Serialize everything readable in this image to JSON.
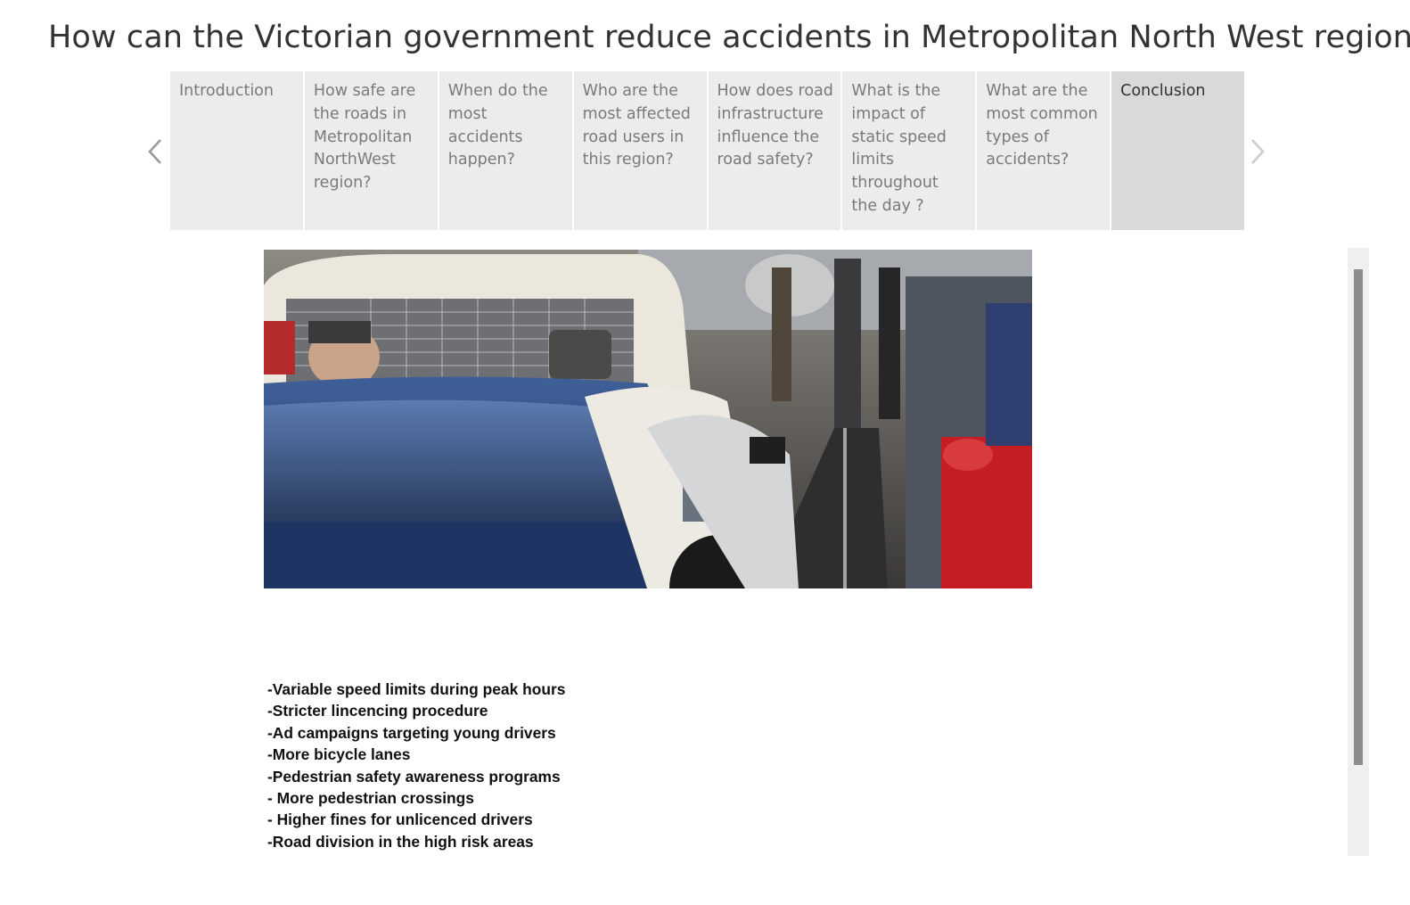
{
  "story": {
    "title": "How can the Victorian government reduce accidents in Metropolitan North West region?"
  },
  "navigation": {
    "prev_icon": "chevron-left-icon",
    "next_icon": "chevron-right-icon",
    "points": [
      {
        "label": "Introduction",
        "active": false
      },
      {
        "label": "How safe are the roads in Metropolitan NorthWest region?",
        "active": false
      },
      {
        "label": "When do the most accidents happen?",
        "active": false
      },
      {
        "label": "Who are the most affected road users in this region?",
        "active": false
      },
      {
        "label": "How does road infrastructure influence the road safety?",
        "active": false
      },
      {
        "label": "What is the impact of static speed limits throughout the day ?",
        "active": false
      },
      {
        "label": "What are the most common types of accidents?",
        "active": false
      },
      {
        "label": "Conclusion",
        "active": true
      }
    ]
  },
  "content": {
    "recommendations": [
      "-Variable speed limits during peak hours",
      "-Stricter lincencing procedure",
      "-Ad campaigns targeting young drivers",
      "-More bicycle lanes",
      "-Pedestrian safety awareness programs",
      "- More pedestrian crossings",
      "- Higher fines for unlicenced drivers",
      "-Road division in the high risk areas"
    ]
  },
  "colors": {
    "tab_inactive": "#ececec",
    "tab_active": "#d9d9d9",
    "scrollbar_thumb": "#8c8c8c"
  }
}
